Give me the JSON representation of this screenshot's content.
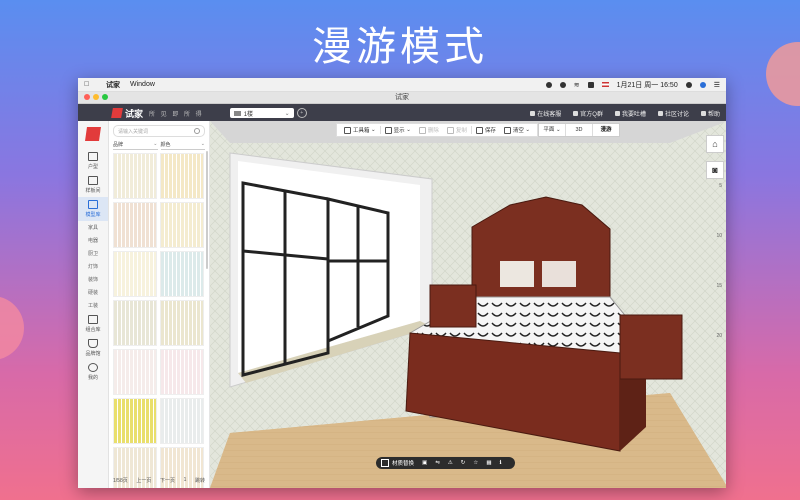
{
  "headline": "漫游模式",
  "menubar": {
    "app_name": "试家",
    "window_menu": "Window",
    "clock": "1月21日 周一  16:50"
  },
  "window": {
    "title": "试家"
  },
  "app_header": {
    "brand": "试家",
    "slogan": "所 见 即 所 得",
    "floor": "1楼",
    "links": [
      "在线客服",
      "官方Q群",
      "我要吐槽",
      "社区讨论",
      "帮助"
    ]
  },
  "nav": {
    "items": [
      {
        "label": "户型",
        "icon": "pencil-icon"
      },
      {
        "label": "样板间",
        "icon": "home-icon"
      },
      {
        "label": "模型库",
        "icon": "monitor-icon",
        "active": true
      }
    ],
    "subitems": [
      "家具",
      "电器",
      "厨卫",
      "灯饰",
      "装饰",
      "硬装",
      "工装"
    ],
    "items2": [
      {
        "label": "组合库",
        "icon": "box-icon"
      },
      {
        "label": "品牌馆",
        "icon": "shield-icon"
      },
      {
        "label": "我的",
        "icon": "user-icon"
      }
    ]
  },
  "panel": {
    "search_placeholder": "请输入关键词",
    "filter_brand": "品牌",
    "filter_color": "颜色",
    "page_info": "1/58页",
    "prev": "上一页",
    "next": "下一页",
    "page_num": "1",
    "jump": "跳转",
    "swatch_colors": [
      "#f1ecd9",
      "#f4e8c6",
      "#f0e1d3",
      "#f4ecd0",
      "#f7f2dd",
      "#dceaea",
      "#e8e6d6",
      "#ebe6cf",
      "#f5ecea",
      "#f6e8ea",
      "#e9df6c",
      "#e9ecec",
      "#efe7d5",
      "#f1e6d3"
    ]
  },
  "toolbar": {
    "items": [
      {
        "label": "工具箱",
        "icon": "toolbox-icon",
        "dropdown": true
      },
      {
        "label": "显示",
        "icon": "eye-icon",
        "dropdown": true
      },
      {
        "label": "删除",
        "icon": "trash-icon",
        "disabled": true
      },
      {
        "label": "复制",
        "icon": "copy-icon",
        "disabled": true
      },
      {
        "label": "保存",
        "icon": "save-icon"
      },
      {
        "label": "清空",
        "icon": "broom-icon",
        "dropdown": true
      }
    ],
    "view_modes": [
      "平面",
      "3D",
      "漫游"
    ],
    "active_view": "漫游"
  },
  "ruler_numbers": [
    "5",
    "10",
    "15",
    "20"
  ],
  "bottom_bar": {
    "material_label": "材质替换"
  }
}
